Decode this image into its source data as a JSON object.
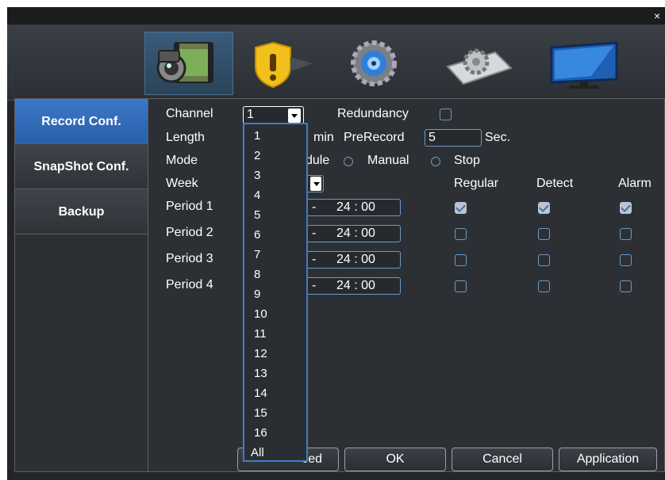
{
  "window": {
    "close_label": "×"
  },
  "toolbar": {
    "icons": [
      "record-camera-icon",
      "alarm-shield-icon",
      "network-gear-icon",
      "system-settings-icon",
      "monitor-icon"
    ]
  },
  "sidebar": {
    "items": [
      {
        "label": "Record Conf."
      },
      {
        "label": "SnapShot Conf."
      },
      {
        "label": "Backup"
      }
    ]
  },
  "form": {
    "channel_label": "Channel",
    "channel_value": "1",
    "redundancy_label": "Redundancy",
    "length_label": "Length",
    "min_label": "min",
    "prerecord_label": "PreRecord",
    "prerecord_value": "5",
    "sec_label": "Sec.",
    "mode_label": "Mode",
    "schedule_label": "dule",
    "manual_label": "Manual",
    "stop_label": "Stop",
    "week_label": "Week",
    "col_regular": "Regular",
    "col_detect": "Detect",
    "col_alarm": "Alarm",
    "periods": [
      {
        "label": "Period 1",
        "end": "24 : 00",
        "regular": true,
        "detect": true,
        "alarm": true
      },
      {
        "label": "Period 2",
        "end": "24 : 00",
        "regular": false,
        "detect": false,
        "alarm": false
      },
      {
        "label": "Period 3",
        "end": "24 : 00",
        "regular": false,
        "detect": false,
        "alarm": false
      },
      {
        "label": "Period 4",
        "end": "24 : 00",
        "regular": false,
        "detect": false,
        "alarm": false
      }
    ],
    "dash": "-"
  },
  "channel_dropdown": {
    "options": [
      "1",
      "2",
      "3",
      "4",
      "5",
      "6",
      "7",
      "8",
      "9",
      "10",
      "11",
      "12",
      "13",
      "14",
      "15",
      "16",
      "All"
    ]
  },
  "buttons": {
    "advanced_partial": "ced",
    "ok": "OK",
    "cancel": "Cancel",
    "application": "Application"
  },
  "colors": {
    "accent": "#3f7cc8",
    "active_tab": "#3b78c8",
    "background": "#232629"
  }
}
